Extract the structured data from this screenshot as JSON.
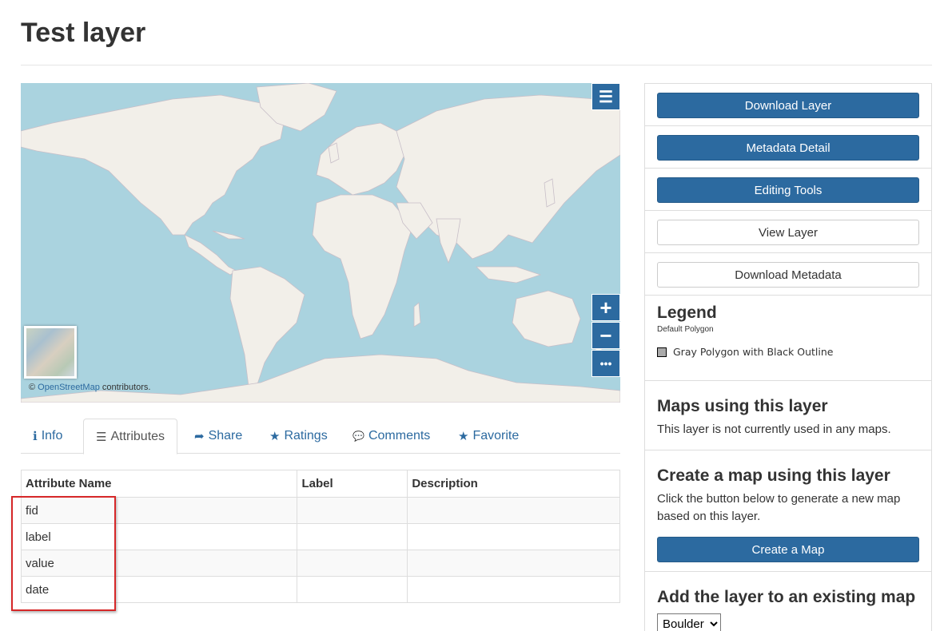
{
  "page": {
    "title": "Test layer"
  },
  "map": {
    "menu_icon": "hamburger-icon",
    "zoom_in": "+",
    "zoom_out": "−",
    "more": "•••",
    "attribution_prefix": "©",
    "attribution_link": "OpenStreetMap",
    "attribution_suffix": " contributors."
  },
  "tabs": [
    {
      "label": "Info",
      "icon": "info-circle-icon",
      "glyph": "ℹ"
    },
    {
      "label": "Attributes",
      "icon": "list-icon",
      "glyph": "☰"
    },
    {
      "label": "Share",
      "icon": "share-icon",
      "glyph": "➦"
    },
    {
      "label": "Ratings",
      "icon": "star-icon",
      "glyph": "★"
    },
    {
      "label": "Comments",
      "icon": "comment-icon",
      "glyph": "💬"
    },
    {
      "label": "Favorite",
      "icon": "star-icon",
      "glyph": "★"
    }
  ],
  "attributes_table": {
    "headers": [
      "Attribute Name",
      "Label",
      "Description"
    ],
    "rows": [
      [
        "fid",
        "",
        ""
      ],
      [
        "label",
        "",
        ""
      ],
      [
        "value",
        "",
        ""
      ],
      [
        "date",
        "",
        ""
      ]
    ]
  },
  "sidebar": {
    "download_layer": "Download Layer",
    "metadata_detail": "Metadata Detail",
    "editing_tools": "Editing Tools",
    "view_layer": "View Layer",
    "download_metadata": "Download Metadata",
    "legend": {
      "title": "Legend",
      "subtitle": "Default Polygon",
      "item": "Gray Polygon with Black Outline",
      "swatch_color": "#aaaaaa"
    },
    "maps_using": {
      "title": "Maps using this layer",
      "text": "This layer is not currently used in any maps."
    },
    "create_map": {
      "title": "Create a map using this layer",
      "text": "Click the button below to generate a new map based on this layer.",
      "button": "Create a Map"
    },
    "add_existing": {
      "title": "Add the layer to an existing map",
      "selected": "Boulder"
    }
  },
  "colors": {
    "primary": "#2c6aa0",
    "ocean": "#aad3df",
    "land": "#f2efe9",
    "highlight": "#d62728"
  }
}
